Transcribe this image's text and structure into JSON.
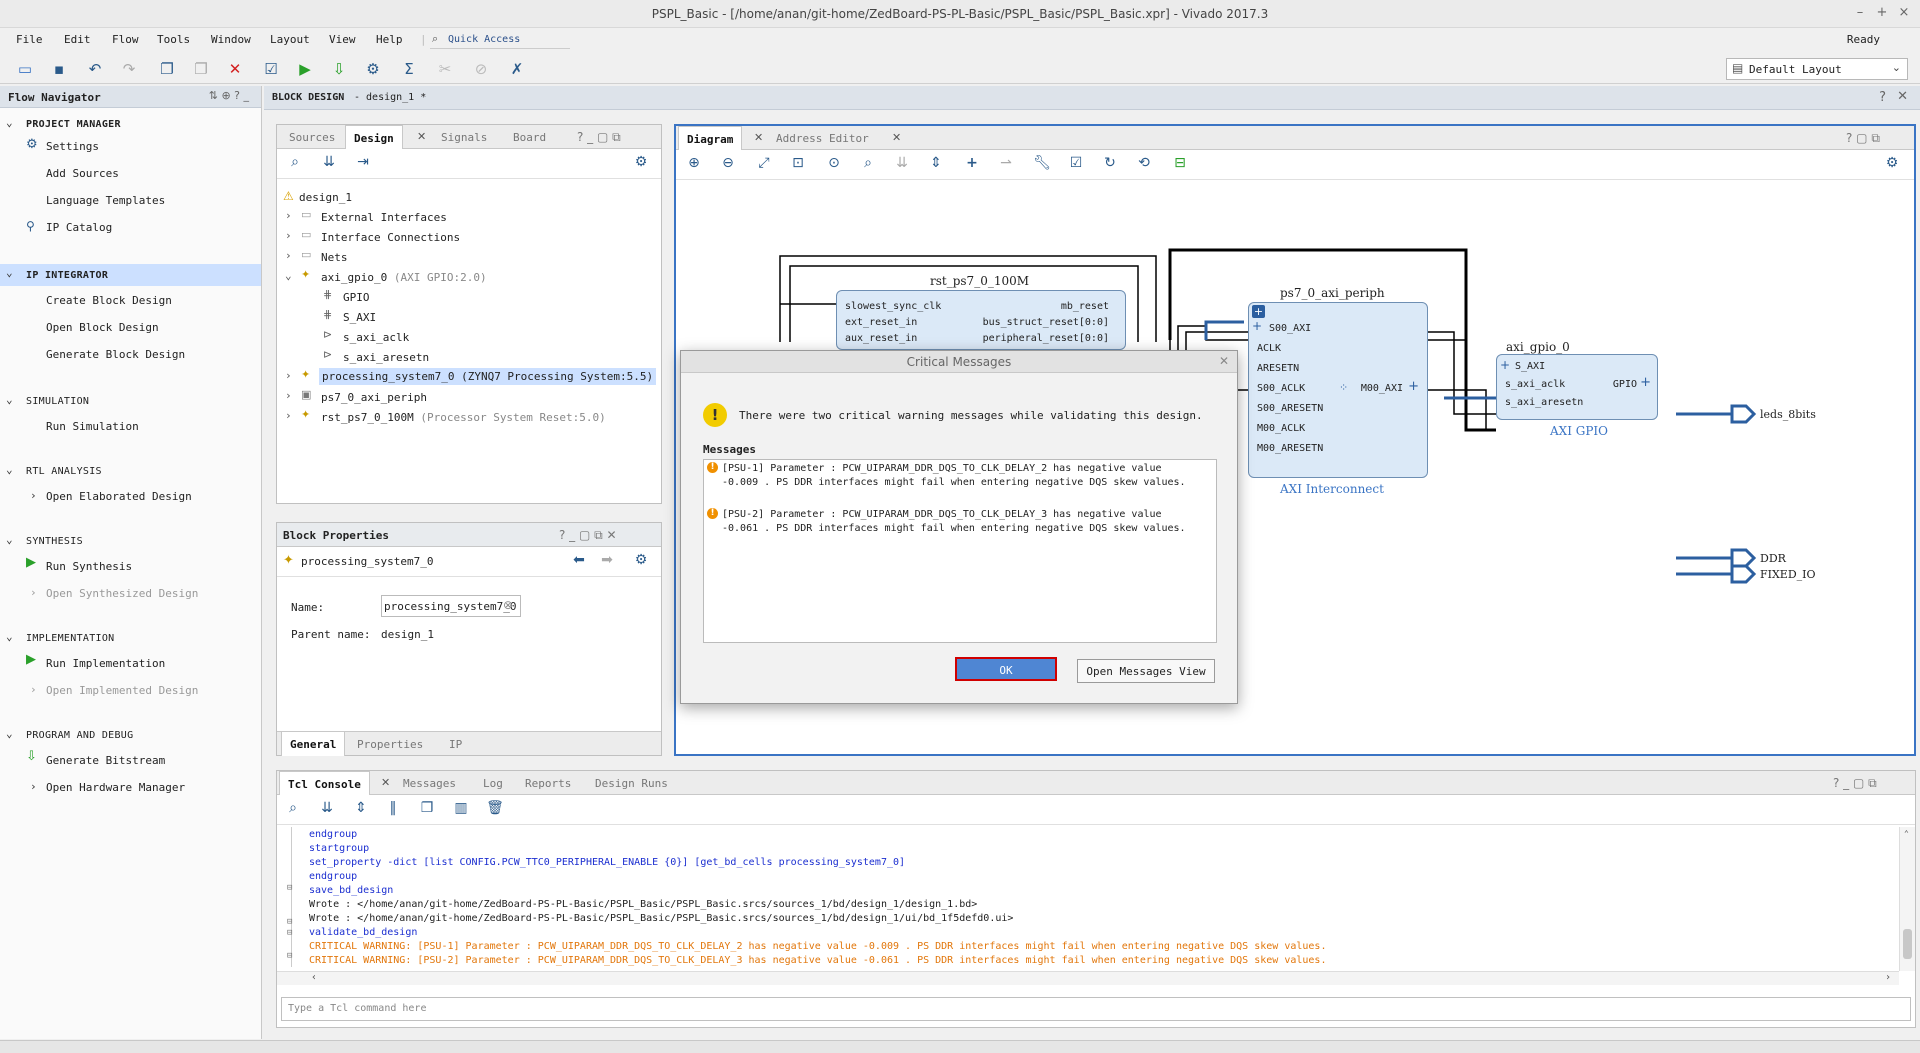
{
  "window": {
    "title": "PSPL_Basic - [/home/anan/git-home/ZedBoard-PS-PL-Basic/PSPL_Basic/PSPL_Basic.xpr] - Vivado 2017.3",
    "status": "Ready"
  },
  "menu": {
    "items": [
      "File",
      "Edit",
      "Flow",
      "Tools",
      "Window",
      "Layout",
      "View",
      "Help"
    ],
    "quick_access": "Quick Access"
  },
  "toolbar": {
    "layout_select": "Default Layout"
  },
  "flow_navigator": {
    "title": "Flow Navigator",
    "sections": [
      {
        "label": "PROJECT MANAGER",
        "items": [
          "Settings",
          "Add Sources",
          "Language Templates",
          "IP Catalog"
        ]
      },
      {
        "label": "IP INTEGRATOR",
        "items": [
          "Create Block Design",
          "Open Block Design",
          "Generate Block Design"
        ]
      },
      {
        "label": "SIMULATION",
        "items": [
          "Run Simulation"
        ]
      },
      {
        "label": "RTL ANALYSIS",
        "items": [
          "Open Elaborated Design"
        ]
      },
      {
        "label": "SYNTHESIS",
        "items": [
          "Run Synthesis",
          "Open Synthesized Design"
        ]
      },
      {
        "label": "IMPLEMENTATION",
        "items": [
          "Run Implementation",
          "Open Implemented Design"
        ]
      },
      {
        "label": "PROGRAM AND DEBUG",
        "items": [
          "Generate Bitstream",
          "Open Hardware Manager"
        ]
      }
    ]
  },
  "block_design": {
    "header_label": "BLOCK DESIGN",
    "header_name": "- design_1 *"
  },
  "sources_panel": {
    "tabs": [
      "Sources",
      "Design",
      "Signals",
      "Board"
    ],
    "tree": {
      "root": "design_1",
      "external_interfaces": "External Interfaces",
      "interface_connections": "Interface Connections",
      "nets": "Nets",
      "axi_gpio": "axi_gpio_0",
      "axi_gpio_type": "(AXI GPIO:2.0)",
      "gpio_children": [
        "GPIO",
        "S_AXI",
        "s_axi_aclk",
        "s_axi_aresetn"
      ],
      "ps7": "processing_system7_0",
      "ps7_type": "(ZYNQ7 Processing System:5.5)",
      "periph": "ps7_0_axi_periph",
      "rst": "rst_ps7_0_100M",
      "rst_type": "(Processor System Reset:5.0)"
    }
  },
  "block_properties": {
    "title": "Block Properties",
    "selected": "processing_system7_0",
    "name_label": "Name:",
    "name_value": "processing_system7_0",
    "parent_label": "Parent name:",
    "parent_value": "design_1",
    "tabs": [
      "General",
      "Properties",
      "IP"
    ]
  },
  "diagram_panel": {
    "tabs": [
      "Diagram",
      "Address Editor"
    ],
    "blocks": {
      "rst": {
        "title": "rst_ps7_0_100M",
        "inputs": [
          "slowest_sync_clk",
          "ext_reset_in",
          "aux_reset_in"
        ],
        "outputs": [
          "mb_reset",
          "bus_struct_reset[0:0]",
          "peripheral_reset[0:0]"
        ]
      },
      "periph": {
        "title": "ps7_0_axi_periph",
        "inputs": [
          "S00_AXI",
          "ACLK",
          "ARESETN",
          "S00_ACLK",
          "S00_ARESETN",
          "M00_ACLK",
          "M00_ARESETN"
        ],
        "output": "M00_AXI",
        "footer": "AXI Interconnect"
      },
      "gpio": {
        "title": "axi_gpio_0",
        "inputs": [
          "S_AXI",
          "s_axi_aclk",
          "s_axi_aresetn"
        ],
        "output": "GPIO",
        "footer": "AXI GPIO"
      }
    },
    "external_ports": [
      "leds_8bits",
      "DDR",
      "FIXED_IO"
    ]
  },
  "dialog": {
    "title": "Critical Messages",
    "summary": "There were two critical warning messages while validating this design.",
    "messages_label": "Messages",
    "messages": [
      {
        "id": "[PSU-1]",
        "line1": "Parameter : PCW_UIPARAM_DDR_DQS_TO_CLK_DELAY_2 has negative value",
        "line2": "-0.009 . PS DDR interfaces might fail when entering negative DQS skew values."
      },
      {
        "id": "[PSU-2]",
        "line1": "Parameter : PCW_UIPARAM_DDR_DQS_TO_CLK_DELAY_3 has negative value",
        "line2": "-0.061 . PS DDR interfaces might fail when entering negative DQS skew values."
      }
    ],
    "ok_label": "OK",
    "open_messages_label": "Open Messages View"
  },
  "console": {
    "tabs": [
      "Tcl Console",
      "Messages",
      "Log",
      "Reports",
      "Design Runs"
    ],
    "lines": [
      {
        "text": "endgroup",
        "style": "blue"
      },
      {
        "text": "startgroup",
        "style": "blue"
      },
      {
        "text": "set_property -dict [list CONFIG.PCW_TTC0_PERIPHERAL_ENABLE {0}] [get_bd_cells processing_system7_0]",
        "style": "blue"
      },
      {
        "text": "endgroup",
        "style": "blue"
      },
      {
        "text": "save_bd_design",
        "style": "blue"
      },
      {
        "text": "Wrote  : </home/anan/git-home/ZedBoard-PS-PL-Basic/PSPL_Basic/PSPL_Basic.srcs/sources_1/bd/design_1/design_1.bd>",
        "style": "black"
      },
      {
        "text": "Wrote  : </home/anan/git-home/ZedBoard-PS-PL-Basic/PSPL_Basic/PSPL_Basic.srcs/sources_1/bd/design_1/ui/bd_1f5defd0.ui>",
        "style": "black"
      },
      {
        "text": "validate_bd_design",
        "style": "blue"
      },
      {
        "text": "CRITICAL WARNING: [PSU-1]  Parameter : PCW_UIPARAM_DDR_DQS_TO_CLK_DELAY_2 has negative value -0.009 . PS DDR interfaces might fail when entering negative DQS skew values.",
        "style": "orange"
      },
      {
        "text": "CRITICAL WARNING: [PSU-2]  Parameter : PCW_UIPARAM_DDR_DQS_TO_CLK_DELAY_3 has negative value -0.061 . PS DDR interfaces might fail when entering negative DQS skew values.",
        "style": "orange"
      }
    ],
    "input_placeholder": "Type a Tcl command here"
  },
  "colors": {
    "accent": "#3a74c4",
    "warning": "#e2770c",
    "highlight": "#cce0ff"
  }
}
